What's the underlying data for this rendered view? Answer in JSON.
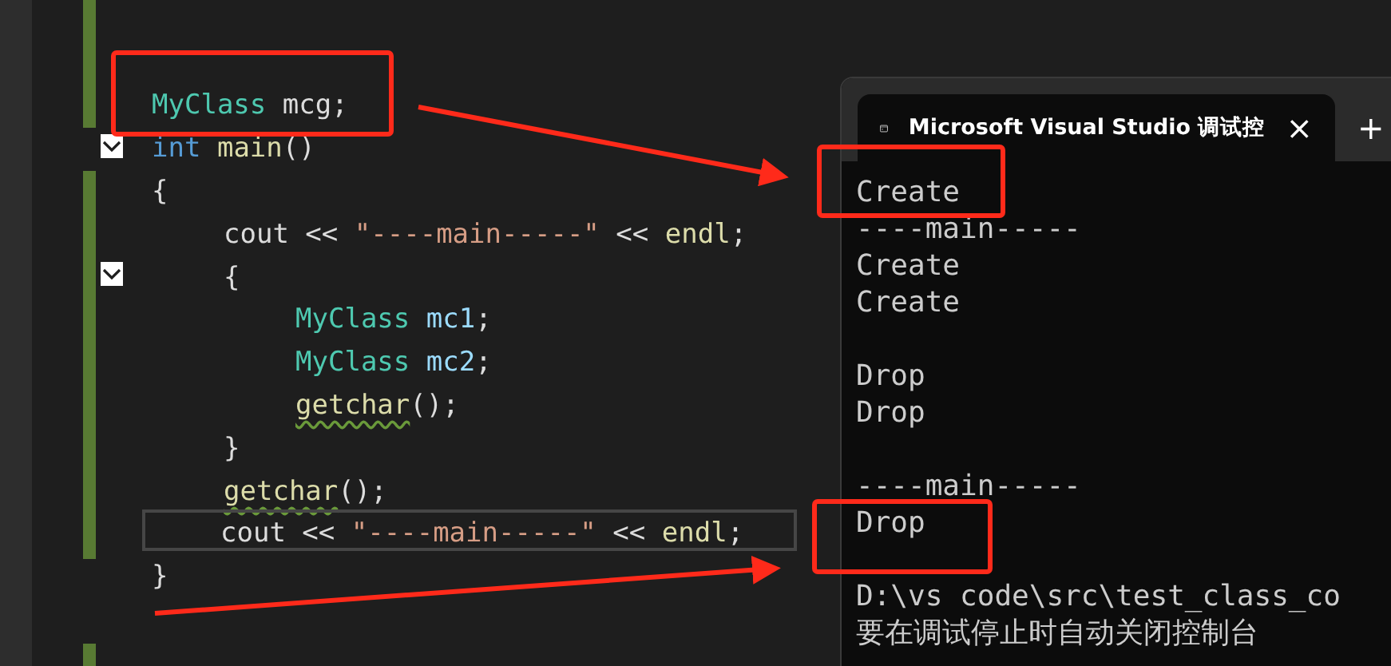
{
  "editor": {
    "lines": [
      {
        "tokens": [
          {
            "kind": "type",
            "text": "MyClass"
          },
          {
            "kind": "plain",
            "text": " mcg;"
          }
        ]
      },
      {
        "fold": true,
        "tokens": [
          {
            "kind": "keyword",
            "text": "int "
          },
          {
            "kind": "function",
            "text": "main"
          },
          {
            "kind": "plain",
            "text": "()"
          }
        ]
      },
      {
        "tokens": [
          {
            "kind": "plain",
            "text": "{"
          }
        ],
        "children": [
          {
            "tokens": [
              {
                "kind": "plain",
                "text": "cout << "
              },
              {
                "kind": "string",
                "text": "\"----main-----\""
              },
              {
                "kind": "plain",
                "text": " << "
              },
              {
                "kind": "function",
                "text": "endl"
              },
              {
                "kind": "plain",
                "text": ";"
              }
            ]
          },
          {
            "fold": true,
            "tokens": [
              {
                "kind": "plain",
                "text": "{"
              }
            ],
            "children": [
              {
                "tokens": [
                  {
                    "kind": "type",
                    "text": "MyClass "
                  },
                  {
                    "kind": "var",
                    "text": "mc1"
                  },
                  {
                    "kind": "plain",
                    "text": ";"
                  }
                ]
              },
              {
                "tokens": [
                  {
                    "kind": "type",
                    "text": "MyClass "
                  },
                  {
                    "kind": "var",
                    "text": "mc2"
                  },
                  {
                    "kind": "plain",
                    "text": ";"
                  }
                ]
              },
              {
                "tokens": [
                  {
                    "kind": "function",
                    "text": "getchar",
                    "warning": true
                  },
                  {
                    "kind": "plain",
                    "text": "();"
                  }
                ]
              }
            ]
          },
          {
            "tokens": [
              {
                "kind": "plain",
                "text": "}"
              }
            ]
          },
          {
            "tokens": [
              {
                "kind": "function",
                "text": "getchar",
                "warning": true
              },
              {
                "kind": "plain",
                "text": "();"
              }
            ]
          },
          {
            "current": true,
            "tokens": [
              {
                "kind": "plain",
                "text": "cout << "
              },
              {
                "kind": "string",
                "text": "\"----main-----\""
              },
              {
                "kind": "plain",
                "text": " << "
              },
              {
                "kind": "function",
                "text": "endl"
              },
              {
                "kind": "plain",
                "text": ";"
              }
            ]
          }
        ]
      },
      {
        "tokens": [
          {
            "kind": "plain",
            "text": "}"
          }
        ]
      }
    ]
  },
  "console": {
    "tab": {
      "title": "Microsoft Visual Studio 调试控",
      "close": "×"
    },
    "new_tab": "+",
    "blocks": [
      [
        "Create",
        "----main-----",
        "Create",
        "Create"
      ],
      [
        "Drop",
        "Drop"
      ],
      [
        "----main-----",
        "Drop"
      ],
      [
        "D:\\vs code\\src\\test_class_co",
        "要在调试停止时自动关闭控制台"
      ]
    ]
  }
}
